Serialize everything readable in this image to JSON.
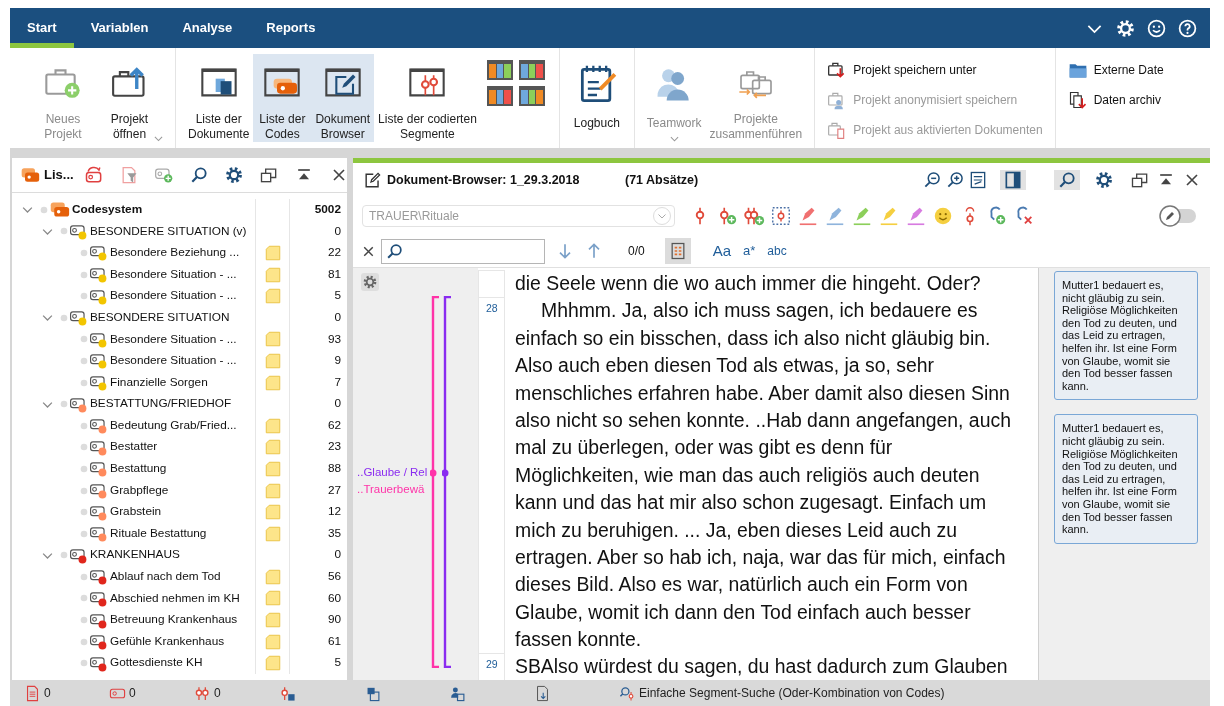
{
  "menu_tabs": [
    {
      "label": "Start",
      "selected": true
    },
    {
      "label": "Variablen",
      "selected": false
    },
    {
      "label": "Analyse",
      "selected": false
    },
    {
      "label": "Reports",
      "selected": false
    }
  ],
  "ribbon": {
    "groups": [
      {
        "kind": "large",
        "buttons": [
          {
            "label": "Neues\nProjekt",
            "disabled": true,
            "selected": false
          },
          {
            "label": "Projekt\nöffnen",
            "disabled": false,
            "selected": false,
            "dropdown": true
          }
        ]
      },
      {
        "kind": "large",
        "buttons": [
          {
            "label": "Liste der\nDokumente",
            "disabled": false,
            "selected": false
          },
          {
            "label": "Liste der\nCodes",
            "disabled": false,
            "selected": true
          },
          {
            "label": "Dokument\nBrowser",
            "disabled": false,
            "selected": true
          },
          {
            "label": "Liste der codierten\nSegmente",
            "disabled": false,
            "selected": false
          },
          {
            "kind": "layouts",
            "selected": false
          }
        ]
      },
      {
        "kind": "large",
        "buttons": [
          {
            "label": "Logbuch",
            "disabled": false,
            "selected": false
          }
        ]
      },
      {
        "kind": "large",
        "buttons": [
          {
            "label": "Teamwork",
            "disabled": true,
            "selected": false,
            "dropdown": true
          },
          {
            "label": "Projekte\nzusammenführen",
            "disabled": true,
            "selected": false
          }
        ]
      },
      {
        "kind": "list",
        "items": [
          {
            "label": "Projekt speichern unter",
            "disabled": false
          },
          {
            "label": "Projekt anonymisiert speichern",
            "disabled": true
          },
          {
            "label": "Projekt aus aktivierten Dokumenten",
            "disabled": true
          }
        ]
      },
      {
        "kind": "list",
        "items": [
          {
            "label": "Externe Date",
            "disabled": false
          },
          {
            "label": "Daten archiv",
            "disabled": false
          }
        ]
      }
    ]
  },
  "code_panel": {
    "title": "Lis...",
    "tree": {
      "label": "Codesystem",
      "count": "5002",
      "expanded": true,
      "children": [
        {
          "label": "BESONDERE SITUATION (v)",
          "color": "#f2c500",
          "count": "0",
          "expanded": true,
          "memo": false,
          "children": [
            {
              "label": "Besondere Beziehung ...",
              "color": "#f2c500",
              "count": "22",
              "memo": true
            },
            {
              "label": "Besondere Situation - ...",
              "color": "#f2c500",
              "count": "81",
              "memo": true
            },
            {
              "label": "Besondere Situation - ...",
              "color": "#f2c500",
              "count": "5",
              "memo": true
            }
          ]
        },
        {
          "label": "BESONDERE SITUATION",
          "color": "#f2c500",
          "count": "0",
          "expanded": true,
          "memo": false,
          "children": [
            {
              "label": "Besondere Situation - ...",
              "color": "#f2c500",
              "count": "93",
              "memo": true
            },
            {
              "label": "Besondere Situation - ...",
              "color": "#f2c500",
              "count": "9",
              "memo": true
            },
            {
              "label": "Finanzielle Sorgen",
              "color": "#f2c500",
              "count": "7",
              "memo": true
            }
          ]
        },
        {
          "label": "BESTATTUNG/FRIEDHOF",
          "color": "#ff8a5c",
          "count": "0",
          "expanded": true,
          "memo": false,
          "children": [
            {
              "label": "Bedeutung Grab/Fried...",
              "color": "#ff8a5c",
              "count": "62",
              "memo": true
            },
            {
              "label": "Bestatter",
              "color": "#ff8a5c",
              "count": "23",
              "memo": true
            },
            {
              "label": "Bestattung",
              "color": "#ff8a5c",
              "count": "88",
              "memo": true
            },
            {
              "label": "Grabpflege",
              "color": "#ff8a5c",
              "count": "27",
              "memo": true
            },
            {
              "label": "Grabstein",
              "color": "#ff8a5c",
              "count": "12",
              "memo": true
            },
            {
              "label": "Rituale Bestattung",
              "color": "#ff8a5c",
              "count": "35",
              "memo": true
            }
          ]
        },
        {
          "label": "KRANKENHAUS",
          "color": "#e0261c",
          "count": "0",
          "expanded": true,
          "memo": false,
          "children": [
            {
              "label": "Ablauf nach dem Tod",
              "color": "#e0261c",
              "count": "56",
              "memo": true
            },
            {
              "label": "Abschied nehmen im KH",
              "color": "#e0261c",
              "count": "60",
              "memo": true
            },
            {
              "label": "Betreuung Krankenhaus",
              "color": "#e0261c",
              "count": "90",
              "memo": true
            },
            {
              "label": "Gefühle Krankenhaus",
              "color": "#e0261c",
              "count": "61",
              "memo": true
            },
            {
              "label": "Gottesdienste KH",
              "color": "#e0261c",
              "count": "5",
              "memo": true
            }
          ]
        }
      ]
    }
  },
  "document_browser": {
    "title": "Dokument-Browser: 1_29.3.2018",
    "subtitle": "(71 Absätze)",
    "tools": [
      {
        "selected": false
      },
      {
        "selected": false
      },
      {
        "selected": false
      },
      {
        "selected": true
      },
      {
        "selected": true
      },
      {
        "selected": false
      },
      {
        "selected": false
      },
      {
        "selected": false
      },
      {
        "selected": false
      }
    ],
    "code_dropdown": "TRAUER\\Rituale",
    "highlighters": [
      {
        "color": "#f07070"
      },
      {
        "color": "#8fb4dc"
      },
      {
        "color": "#8ccf5a"
      },
      {
        "color": "#f5cf40"
      },
      {
        "color": "#d77be0"
      }
    ],
    "edit_mode": false,
    "match_count": "0/0",
    "list_view_selected": true,
    "text_options": [
      "Aa",
      "a*",
      "abc"
    ],
    "paragraphs": [
      {
        "text": "die Seele wenn die wo auch immer die hingeht. Oder?",
        "indented": false
      },
      {
        "number": "28",
        "text": "Mhhmm. Ja, also ich muss sagen, ich bedauere es einfach so ein bisschen, dass ich also nicht gläubig bin. Also auch eben diesen Tod als etwas, ja so, sehr menschliches erfahren habe. Aber damit also diesen Sinn also nicht so sehen konnte. ..Hab dann angefangen, auch mal zu überlegen, oder was gibt es denn für Möglichkeiten, wie man das auch religiös auch deuten kann und das hat mir also schon zugesagt. Einfach um mich zu beruhigen. ... Ja, eben dieses Leid auch zu ertragen. Aber so hab ich, naja, war das für mich, einfach dieses Bild. Also es war, natürlich auch ein Form von Glaube, womit ich dann den Tod einfach auch besser fassen konnte.",
        "indented": true
      },
      {
        "number": "29",
        "text": "SBAlso würdest du sagen, du hast dadurch zum Glauben",
        "indented": false
      }
    ],
    "code_stripes": [
      {
        "label": "..Glaube / Rel",
        "color": "#8a2cf0"
      },
      {
        "label": "..Trauerbewä",
        "color": "#ff33a8"
      }
    ],
    "memos": [
      "Mutter1 bedauert es, nicht gläubig zu sein. Religiöse Möglichkeiten den Tod zu deuten, und das Leid zu ertragen, helfen ihr. Ist eine Form von Glaube, womit sie den Tod besser fassen kann.",
      "Mutter1 bedauert es, nicht gläubig zu sein. Religiöse Möglichkeiten den Tod zu deuten, und das Leid zu ertragen, helfen ihr. Ist eine Form von Glaube, womit sie den Tod besser fassen kann."
    ]
  },
  "status_bar": {
    "counts": [
      "0",
      "0",
      "0"
    ],
    "search_mode": "Einfache Segment-Suche (Oder-Kombination von Codes)"
  }
}
